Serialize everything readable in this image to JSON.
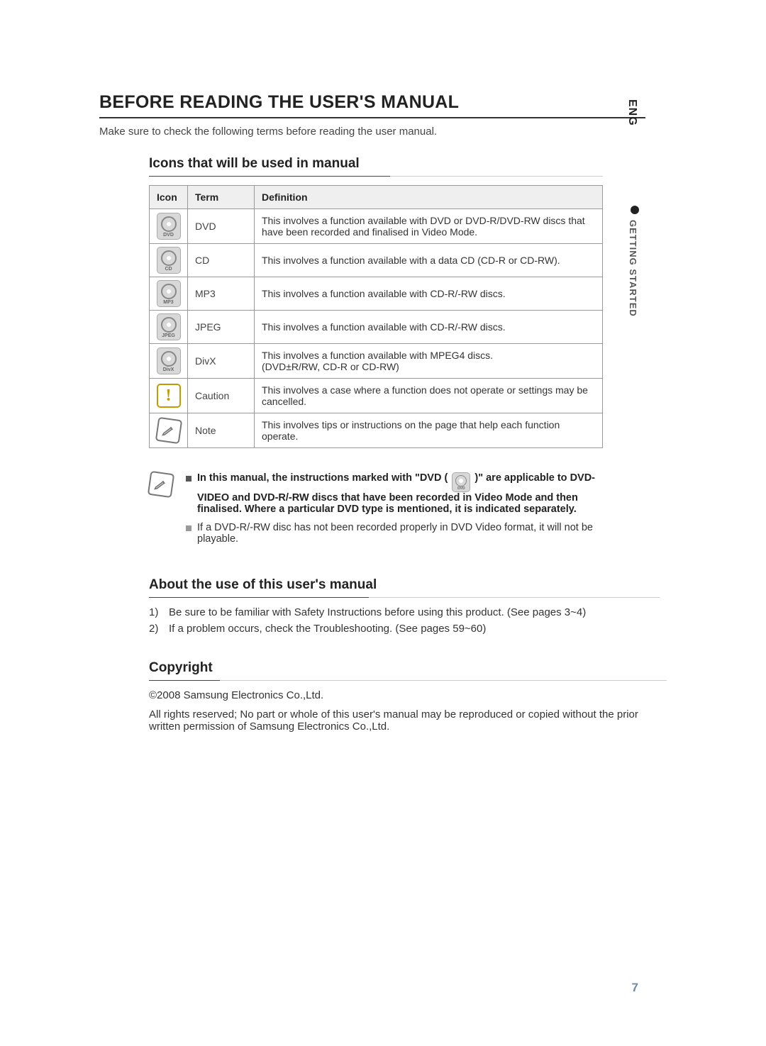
{
  "side": {
    "lang": "ENG",
    "section": "GETTING STARTED"
  },
  "heading": "BEFORE READING THE USER'S MANUAL",
  "intro": "Make sure to check the following terms before reading the user manual.",
  "icons_section_title": "Icons that will be used in manual",
  "table": {
    "headers": {
      "icon": "Icon",
      "term": "Term",
      "definition": "Definition"
    },
    "rows": [
      {
        "icon_label": "DVD",
        "term": "DVD",
        "definition": "This involves a function available with DVD or DVD-R/DVD-RW discs that have been recorded and finalised in Video Mode."
      },
      {
        "icon_label": "CD",
        "term": "CD",
        "definition": "This involves a function available with a data CD (CD-R or CD-RW)."
      },
      {
        "icon_label": "MP3",
        "term": "MP3",
        "definition": "This involves a function available with CD-R/-RW discs."
      },
      {
        "icon_label": "JPEG",
        "term": "JPEG",
        "definition": "This involves a function available with CD-R/-RW discs."
      },
      {
        "icon_label": "DivX",
        "term": "DivX",
        "definition": "This involves a function available with MPEG4 discs.\n(DVD±R/RW, CD-R or CD-RW)"
      },
      {
        "icon_label": "!",
        "term": "Caution",
        "definition": "This involves a case where a function does not operate or settings may be cancelled."
      },
      {
        "icon_label": "note",
        "term": "Note",
        "definition": "This involves tips or instructions on the page that help each function operate."
      }
    ]
  },
  "notes": {
    "item1_pre": "In this manual, the instructions marked with \"DVD (",
    "item1_post": ")\" are applicable to DVD-VIDEO and DVD-R/-RW discs that have been recorded in Video Mode and then finalised. Where a particular DVD type is mentioned, it is indicated separately.",
    "item2": "If a DVD-R/-RW disc has not been recorded properly in DVD Video format, it will not be playable."
  },
  "about_title": "About the use of this user's manual",
  "about_items": [
    {
      "num": "1)",
      "text": "Be sure to be familiar with Safety Instructions before using this product. (See pages 3~4)"
    },
    {
      "num": "2)",
      "text": "If a problem occurs, check the Troubleshooting. (See pages 59~60)"
    }
  ],
  "copyright_title": "Copyright",
  "copyright_body1": "©2008 Samsung Electronics Co.,Ltd.",
  "copyright_body2": "All rights reserved; No part or whole of this user's manual may be reproduced or copied without the prior written permission of Samsung Electronics Co.,Ltd.",
  "page_number": "7"
}
